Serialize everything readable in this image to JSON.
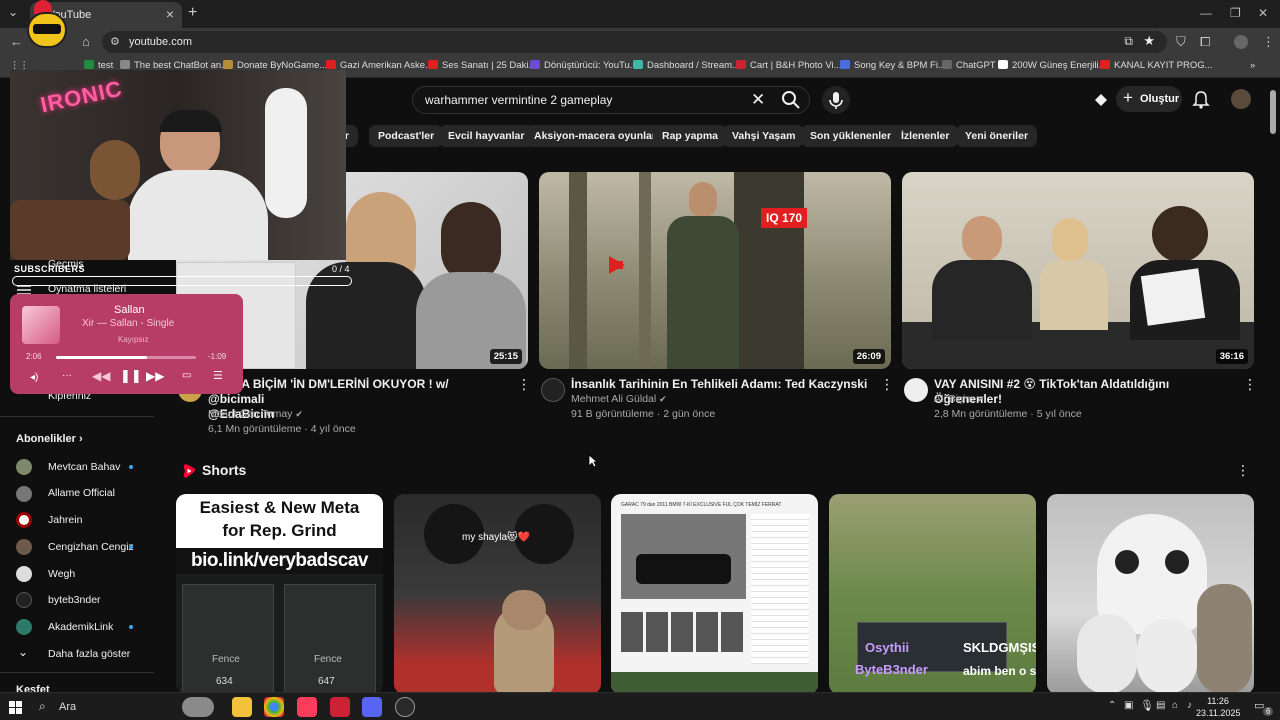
{
  "browser": {
    "tab_title": "YouTube",
    "url": "youtube.com",
    "bookmarks": [
      "test",
      "The best ChatBot an...",
      "Donate ByNoGame...",
      "Gazi Amerikan Aske...",
      "Ses Sanatı | 25 Daki...",
      "Dönüştürücü: YouTu...",
      "Dashboard / Stream...",
      "Cart | B&H Photo Vi...",
      "Song Key & BPM Fi...",
      "ChatGPT",
      "200W Güneş Enerjili...",
      "KANAL KAYIT PROG..."
    ]
  },
  "youtube": {
    "search_query": "warhammer vermintine 2 gameplay",
    "create_label": "Oluştur",
    "chips": [
      "er",
      "Podcast'ler",
      "Evcil hayvanlar",
      "Aksiyon-macera oyunları",
      "Rap yapma",
      "Vahşi Yaşam",
      "Son yüklenenler",
      "İzlenenler",
      "Yeni öneriler"
    ],
    "videos": [
      {
        "title_line1": "İM EDA BİÇİM 'İN DM'LERİNİ OKUYOR ! w/ @bicimali",
        "title_line2": "@EdaBicim",
        "channel": "Mesut Can Tomay",
        "meta": "6,1 Mn görüntüleme · 4 yıl önce",
        "duration": "25:15",
        "overlay_count": "0 / 4"
      },
      {
        "title": "İnsanlık Tarihinin En Tehlikeli Adamı: Ted Kaczynski",
        "channel": "Mehmet Ali Güldal",
        "meta": "91 B görüntüleme · 2 gün önce",
        "duration": "26:09",
        "badge": "IQ 170"
      },
      {
        "title": "VAY ANISINI #2 😵 TikTok'tan Aldatıldığını Öğrenenler!",
        "channel": "Ali Biçim",
        "meta": "2,8 Mn görüntüleme · 5 yıl önce",
        "duration": "36:16"
      }
    ],
    "shorts_heading": "Shorts",
    "shorts": [
      {
        "line1": "Easiest & New Meta",
        "line2": "for Rep. Grind",
        "line3": "bio.link/verybadscav",
        "card_label": "Fence",
        "card_values": [
          "634",
          "647"
        ]
      },
      {
        "caption": "my shayla😻❤️"
      },
      {
        "header": "GARAC 79 dan 2011 BMW 7-Kİ EXCLUSIVE FUL ÇOK TEMİZ FERRAT"
      },
      {
        "chat_user": "Osythii",
        "chat_msg": "SKLDGMŞISOLKIMHŞSILOIEH",
        "chat_user2": "ByteB3nder",
        "chat_msg2": "abim ben o sozu"
      },
      {}
    ]
  },
  "sidebar": {
    "top_items": [
      "Geçmiş",
      "Oynatma listeleri",
      "Kipferlniz"
    ],
    "subscriptions_heading": "Abonelikler",
    "subscriptions": [
      {
        "name": "Mevtcan Bahav",
        "live": true
      },
      {
        "name": "Allame Official",
        "live": false
      },
      {
        "name": "Jahrein",
        "live": false
      },
      {
        "name": "Cengizhan Cengiz",
        "live": true
      },
      {
        "name": "Wegh",
        "live": false
      },
      {
        "name": "byteb3nder",
        "live": false
      },
      {
        "name": "AkademikLink",
        "live": true
      }
    ],
    "show_more": "Daha fazla göster",
    "next_heading": "Keşfet"
  },
  "overlays": {
    "webcam_sign": "IRONIC",
    "subscribers_label": "SUBSCRIBERS",
    "music": {
      "song": "Sallan",
      "subtitle": "Xir — Sallan - Single",
      "mode": "Kayıpsız",
      "elapsed": "2:06",
      "remaining": "-1:09",
      "progress": 0.65
    }
  },
  "taskbar": {
    "search": "Ara",
    "time": "11:26",
    "date": "23.11.2025",
    "notif_count": "6"
  },
  "colors": {
    "accent_red": "#ff0000",
    "chip_bg": "#272727",
    "bg": "#0f0f0f",
    "music_bg": "#b73c66"
  }
}
